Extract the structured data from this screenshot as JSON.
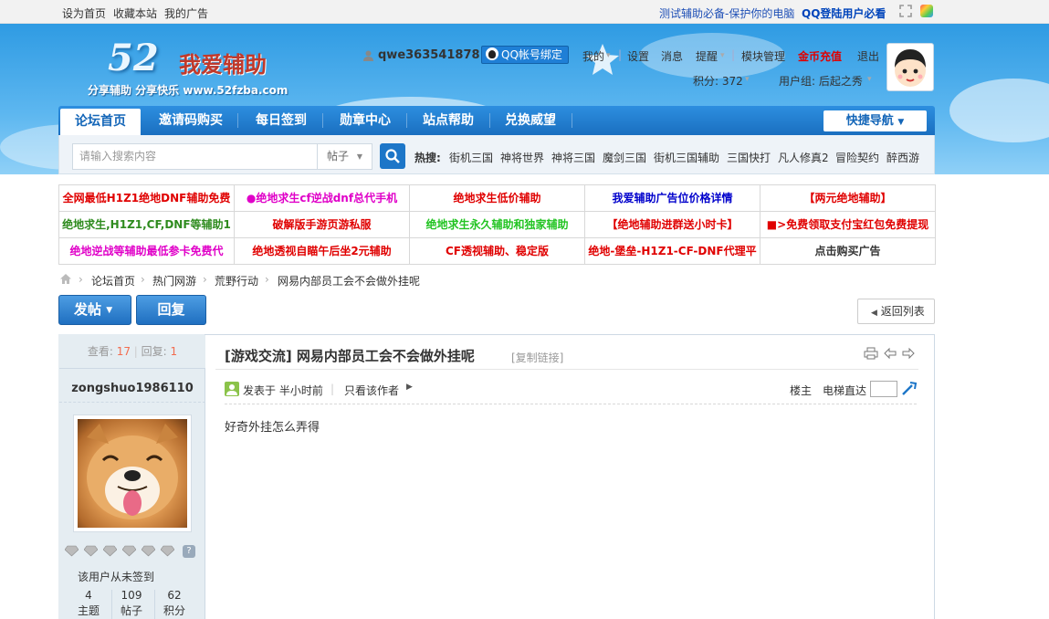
{
  "topbar": {
    "set_home": "设为首页",
    "bookmark": "收藏本站",
    "my_ads": "我的广告",
    "promo": "测试辅助必备-保护你的电脑",
    "qq_login": "QQ登陆用户必看"
  },
  "header": {
    "logo_number": "52",
    "logo_text": "我爱辅助",
    "logo_sub": "分享辅助  分享快乐  www.52fzba.com",
    "username": "qwe363541878",
    "qq_bind": "QQ帐号绑定",
    "menu": {
      "mine": "我的",
      "settings": "设置",
      "messages": "消息",
      "alerts": "提醒",
      "modules": "模块管理",
      "recharge": "金币充值",
      "logout": "退出"
    },
    "points": "积分: 372",
    "group": "用户组: 后起之秀"
  },
  "nav": {
    "items": [
      "论坛首页",
      "邀请码购买",
      "每日签到",
      "勋章中心",
      "站点帮助",
      "兑换威望"
    ],
    "quick": "快捷导航"
  },
  "search": {
    "placeholder": "请输入搜索内容",
    "type": "帖子",
    "hot_label": "热搜:",
    "hot": [
      "街机三国",
      "神将世界",
      "神将三国",
      "魔剑三国",
      "街机三国辅助",
      "三国快打",
      "凡人修真2",
      "冒险契约",
      "醉西游"
    ]
  },
  "ads": [
    [
      {
        "t": "全网最低H1Z1绝地DNF辅助免费",
        "c": "#e00000"
      },
      {
        "t": "●绝地求生cf逆战dnf总代手机",
        "c": "#e000c8"
      },
      {
        "t": "绝地求生低价辅助",
        "c": "#e00000"
      },
      {
        "t": "我爱辅助广告位价格详情",
        "c": "#0000cc"
      },
      {
        "t": "【两元绝地辅助】",
        "c": "#e00000"
      }
    ],
    [
      {
        "t": "绝地求生,H1Z1,CF,DNF等辅助1",
        "c": "#2e8b1e"
      },
      {
        "t": "破解版手游页游私服",
        "c": "#e00000"
      },
      {
        "t": "绝地求生永久辅助和独家辅助",
        "c": "#22c422"
      },
      {
        "t": "【绝地辅助进群送小时卡】",
        "c": "#e00000"
      },
      {
        "t": "■>免费领取支付宝红包免费提现",
        "c": "#e00000"
      }
    ],
    [
      {
        "t": "绝地逆战等辅助最低参卡免费代",
        "c": "#e000c8"
      },
      {
        "t": "绝地透视自瞄午后坐2元辅助",
        "c": "#e00000"
      },
      {
        "t": "CF透视辅助、稳定版",
        "c": "#e00000"
      },
      {
        "t": "绝地-堡垒-H1Z1-CF-DNF代理平",
        "c": "#e00000"
      },
      {
        "t": "点击购买广告",
        "c": "#333333"
      }
    ]
  ],
  "breadcrumb": [
    "论坛首页",
    "热门网游",
    "荒野行动",
    "网易内部员工会不会做外挂呢"
  ],
  "actions": {
    "post": "发帖",
    "reply": "回复",
    "back": "返回列表"
  },
  "thread": {
    "views_label": "查看:",
    "views": "17",
    "replies_label": "回复:",
    "replies": "1",
    "title": "[游戏交流] 网易内部员工会不会做外挂呢",
    "copy_link": "[复制链接]",
    "author": "zongshuo1986110",
    "posted": "发表于 半小时前",
    "only_author": "只看该作者",
    "floor": "楼主",
    "jump": "电梯直达",
    "content": "好奇外挂怎么弄得",
    "signin": "该用户从未签到",
    "stats": [
      {
        "n": "4",
        "l": "主题"
      },
      {
        "n": "109",
        "l": "帖子"
      },
      {
        "n": "62",
        "l": "积分"
      }
    ]
  },
  "colors": {
    "accent": "#1a6fc0",
    "recharge": "#e00000",
    "qq_login": "#0055cc"
  }
}
